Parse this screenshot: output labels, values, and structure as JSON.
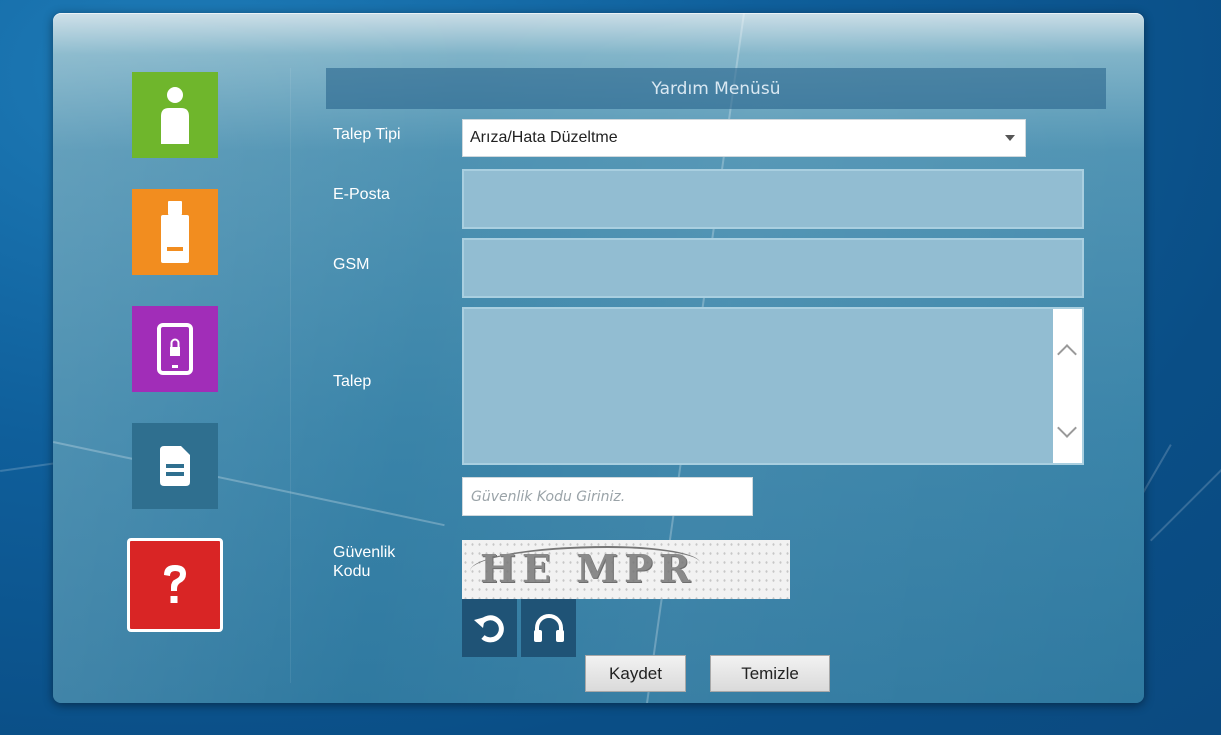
{
  "form": {
    "title": "Yardım Menüsü",
    "request_type_label": "Talep Tipi",
    "request_type_value": "Arıza/Hata Düzeltme",
    "email_label": "E-Posta",
    "email_value": "",
    "gsm_label": "GSM",
    "gsm_value": "",
    "request_label": "Talep",
    "request_value": "",
    "security_code_label": "Güvenlik Kodu",
    "security_code_placeholder": "Güvenlik Kodu Giriniz.",
    "captcha_text": "HE MPR"
  },
  "sidebar": {
    "tiles": [
      {
        "name": "user",
        "color": "#6fb62c",
        "icon": "user-icon"
      },
      {
        "name": "usb",
        "color": "#f28d1f",
        "icon": "usb-icon"
      },
      {
        "name": "mobile-lock",
        "color": "#a12db8",
        "icon": "phone-lock-icon"
      },
      {
        "name": "document",
        "color": "#2f6f8f",
        "icon": "document-icon"
      },
      {
        "name": "help",
        "color": "#d92525",
        "icon": "question-icon",
        "selected": true
      }
    ]
  },
  "buttons": {
    "save": "Kaydet",
    "clear": "Temizle",
    "refresh_icon": "refresh-icon",
    "audio_icon": "headphones-icon"
  }
}
